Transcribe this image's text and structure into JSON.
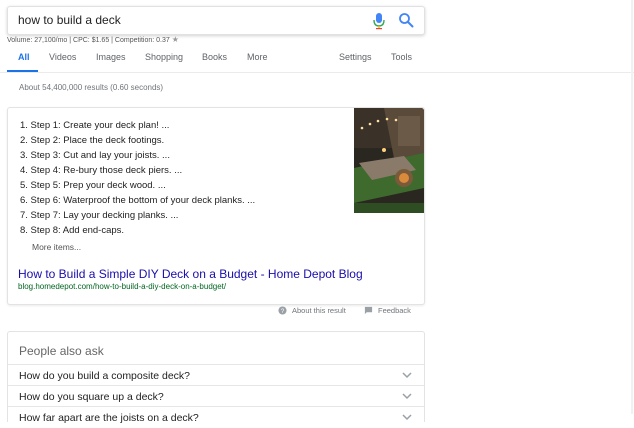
{
  "search": {
    "query": "how to build a deck",
    "mic_icon": "microphone-icon",
    "search_icon": "search-icon"
  },
  "keyword_stats": {
    "text": "Volume: 27,100/mo | CPC: $1.65 | Competition: 0.37",
    "star_icon": "star-icon"
  },
  "tabs": [
    {
      "label": "All",
      "active": true
    },
    {
      "label": "Videos"
    },
    {
      "label": "Images"
    },
    {
      "label": "Shopping"
    },
    {
      "label": "Books"
    },
    {
      "label": "More"
    },
    {
      "label": "Settings"
    },
    {
      "label": "Tools"
    }
  ],
  "result_stats": "About 54,400,000 results (0.60 seconds)",
  "featured_snippet": {
    "steps": [
      "1. Step 1: Create your deck plan! ...",
      "2. Step 2: Place the deck footings.",
      "3. Step 3: Cut and lay your joists. ...",
      "4. Step 4: Re-bury those deck piers. ...",
      "5. Step 5: Prep your deck wood. ...",
      "6. Step 6: Waterproof the bottom of your deck planks. ...",
      "7. Step 7: Lay your decking planks. ...",
      "8. Step 8: Add end-caps."
    ],
    "more_items": "More items...",
    "title": "How to Build a Simple DIY Deck on a Budget - Home Depot Blog",
    "url": "blog.homedepot.com/how-to-build-a-diy-deck-on-a-budget/",
    "about": "About this result",
    "feedback": "Feedback"
  },
  "people_also_ask": {
    "title": "People also ask",
    "questions": [
      "How do you build a composite deck?",
      "How do you square up a deck?",
      "How far apart are the joists on a deck?"
    ]
  },
  "colors": {
    "accent": "#1a73e8",
    "link": "#1a0dab",
    "url": "#006621"
  }
}
